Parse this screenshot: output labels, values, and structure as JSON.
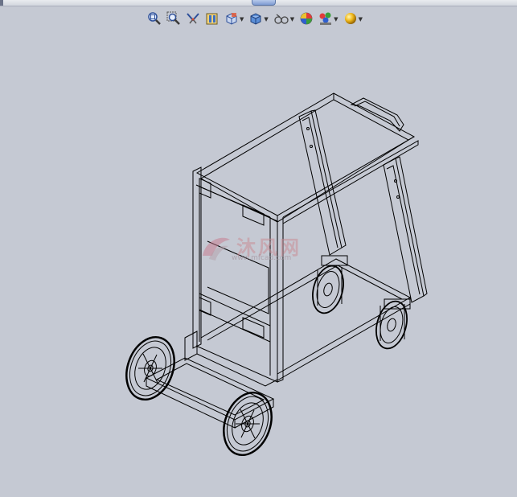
{
  "toolbar": {
    "items": [
      {
        "name": "zoom-to-fit",
        "icon": "zoom-fit-icon",
        "dropdown": false
      },
      {
        "name": "zoom-to-area",
        "icon": "zoom-area-icon",
        "dropdown": false
      },
      {
        "name": "previous-view",
        "icon": "previous-view-icon",
        "dropdown": false
      },
      {
        "name": "section-view",
        "icon": "section-view-icon",
        "dropdown": false
      },
      {
        "name": "view-orientation",
        "icon": "view-orientation-icon",
        "dropdown": true
      },
      {
        "name": "display-style",
        "icon": "display-style-icon",
        "dropdown": true
      },
      {
        "name": "hide-show-items",
        "icon": "hide-show-icon",
        "dropdown": true
      },
      {
        "name": "edit-appearance",
        "icon": "appearance-icon",
        "dropdown": false
      },
      {
        "name": "apply-scene",
        "icon": "scene-icon",
        "dropdown": true
      },
      {
        "name": "view-settings",
        "icon": "view-settings-icon",
        "dropdown": true
      }
    ]
  },
  "model": {
    "subject": "wireframe-welding-cart",
    "line_color": "#000000"
  },
  "watermark": {
    "name": "沐风网",
    "site": "www.mfcad.com"
  },
  "colors": {
    "background": "#c5c9d3",
    "accent_tab": "#7e9bd2"
  }
}
